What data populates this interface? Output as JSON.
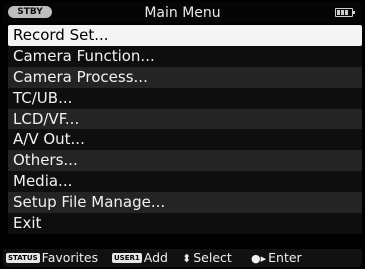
{
  "header": {
    "status": "STBY",
    "title": "Main Menu",
    "battery_icon": "battery-icon"
  },
  "menu": {
    "items": [
      {
        "label": "Record Set..."
      },
      {
        "label": "Camera Function..."
      },
      {
        "label": "Camera Process..."
      },
      {
        "label": "TC/UB..."
      },
      {
        "label": "LCD/VF..."
      },
      {
        "label": "A/V Out..."
      },
      {
        "label": "Others..."
      },
      {
        "label": "Media..."
      },
      {
        "label": "Setup File Manage..."
      },
      {
        "label": "Exit"
      }
    ],
    "selected_label": "Record Set..."
  },
  "guide": {
    "status_tag": "STATUS",
    "favorites": "Favorites",
    "user_tag": "USER1",
    "add": "Add",
    "select_icon": "up-down-icon",
    "select": "Select",
    "enter_icon": "dot-right-icon",
    "enter": "Enter"
  }
}
